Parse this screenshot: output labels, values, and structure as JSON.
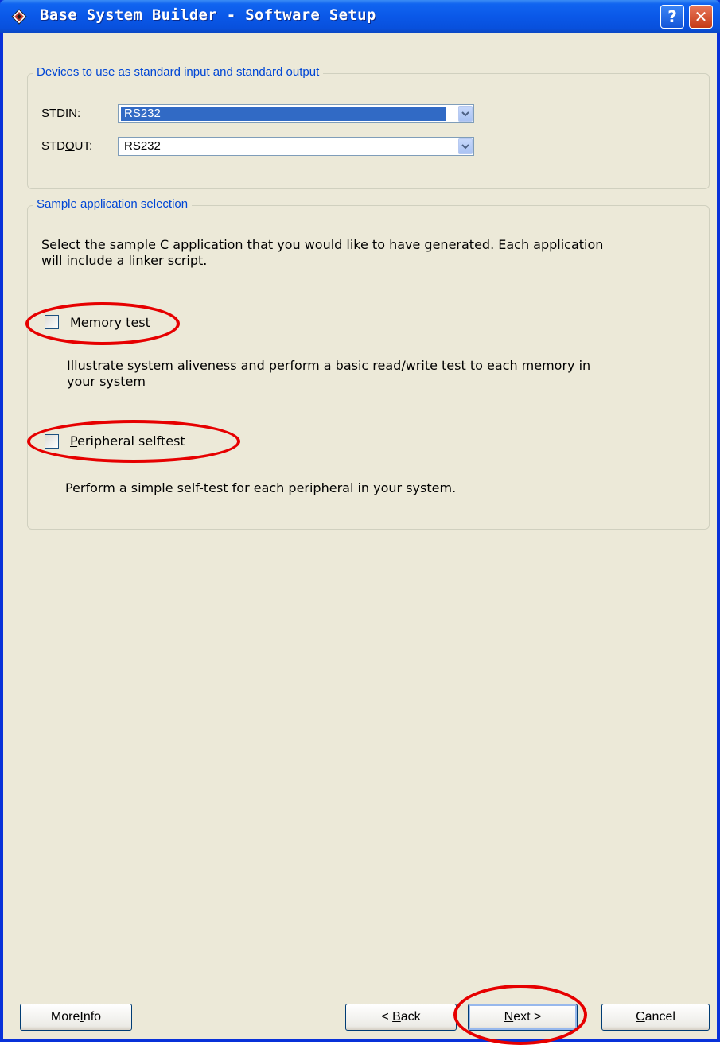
{
  "window": {
    "title": "Base System Builder - Software Setup",
    "help_glyph": "?",
    "close_glyph": "✕",
    "colors": {
      "titlebar": "#0a58e8",
      "client_bg": "#ece9d8",
      "legend": "#0046d5",
      "highlight_ring": "#e60000",
      "selection": "#316ac5"
    }
  },
  "devices_group": {
    "legend": "Devices to use as standard input and standard output",
    "stdin": {
      "label_pre": "STD",
      "label_accel": "I",
      "label_post": "N:",
      "value": "RS232"
    },
    "stdout": {
      "label_pre": "STD",
      "label_accel": "O",
      "label_post": "UT:",
      "value": "RS232"
    }
  },
  "sample_group": {
    "legend": "Sample application selection",
    "intro_line1": "Select the sample C application that you would like to have generated.  Each application",
    "intro_line2": "will include a linker script.",
    "memory_test": {
      "label_pre": "Memory ",
      "label_accel": "t",
      "label_post": "est",
      "checked": false,
      "desc_line1": "Illustrate system aliveness and perform a basic read/write test to each memory in",
      "desc_line2": "your system"
    },
    "peripheral_selftest": {
      "label_accel": "P",
      "label_post": "eripheral selftest",
      "checked": false,
      "desc": "Perform a simple self-test for each peripheral in your system."
    }
  },
  "buttons": {
    "more_info": {
      "pre": "More ",
      "accel": "I",
      "post": "nfo"
    },
    "back": {
      "pre": "< ",
      "accel": "B",
      "post": "ack"
    },
    "next": {
      "pre": "",
      "accel": "N",
      "post": "ext >"
    },
    "cancel": {
      "pre": "",
      "accel": "C",
      "post": "ancel"
    }
  },
  "icons": {
    "title": "app-diamond-icon",
    "dropdown": "chevron-down-icon"
  }
}
